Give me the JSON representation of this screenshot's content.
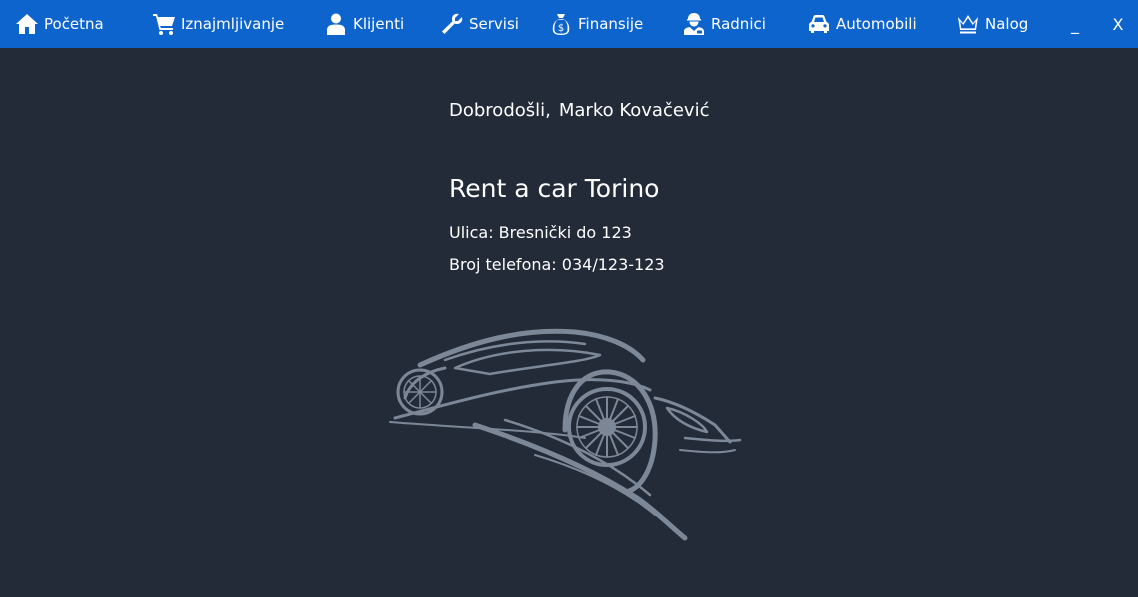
{
  "nav": {
    "items": [
      {
        "label": "Početna",
        "icon": "home-icon"
      },
      {
        "label": "Iznajmljivanje",
        "icon": "cart-icon"
      },
      {
        "label": "Klijenti",
        "icon": "user-icon"
      },
      {
        "label": "Servisi",
        "icon": "wrench-icon"
      },
      {
        "label": "Finansije",
        "icon": "money-bag-icon"
      },
      {
        "label": "Radnici",
        "icon": "worker-icon"
      },
      {
        "label": "Automobili",
        "icon": "car-icon"
      },
      {
        "label": "Nalog",
        "icon": "crown-icon"
      }
    ],
    "minimize_label": "_",
    "close_label": "X"
  },
  "welcome": {
    "greeting": "Dobrodošli,",
    "user_name": "Marko Kovačević"
  },
  "company": {
    "name": "Rent a car Torino",
    "street": "Ulica: Bresnički do 123",
    "phone": "Broj telefona: 034/123-123"
  },
  "colors": {
    "navbar": "#0e64cd",
    "background": "#232b38",
    "logo": "#7c8797"
  }
}
